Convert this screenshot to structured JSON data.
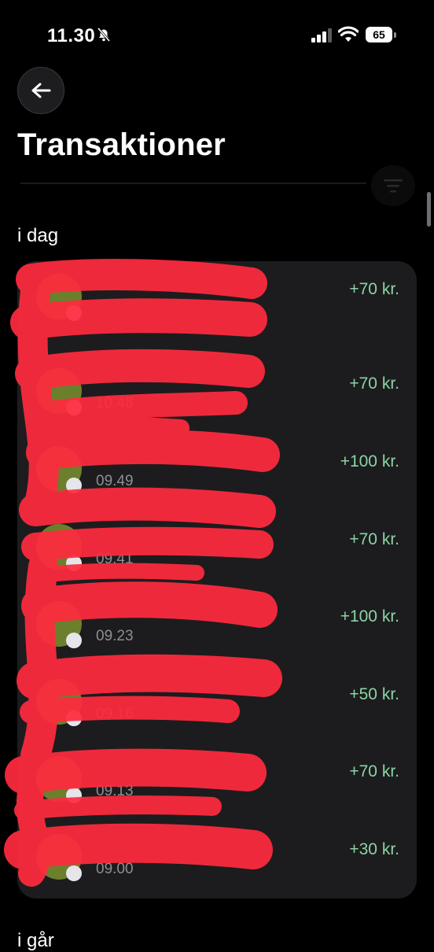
{
  "status_bar": {
    "time": "11.30",
    "battery": "65"
  },
  "header": {
    "title": "Transaktioner"
  },
  "sections": [
    {
      "label": "i dag",
      "transactions": [
        {
          "name": "",
          "time": "",
          "amount": "+70 kr."
        },
        {
          "name": "",
          "time": "10.48",
          "amount": "+70 kr."
        },
        {
          "name": "",
          "time": "09.49",
          "amount": "+100 kr."
        },
        {
          "name": "",
          "time": "09.41",
          "amount": "+70 kr."
        },
        {
          "name": "",
          "time": "09.23",
          "amount": "+100 kr."
        },
        {
          "name": "",
          "time": "09.16",
          "amount": "+50 kr."
        },
        {
          "name": "",
          "time": "09.13",
          "amount": "+70 kr."
        },
        {
          "name": "",
          "time": "09.00",
          "amount": "+30 kr."
        }
      ]
    },
    {
      "label": "i går"
    }
  ],
  "icons": {
    "status": [
      "bell-off-icon",
      "signal-icon",
      "wifi-icon",
      "battery-icon"
    ],
    "header": [
      "arrow-left-icon",
      "filter-icon"
    ]
  },
  "colors": {
    "background": "#000000",
    "card": "#1c1c1e",
    "amount_positive": "#8bd4a6",
    "secondary_text": "#8e8e93",
    "redaction": "#ff2b3f"
  }
}
